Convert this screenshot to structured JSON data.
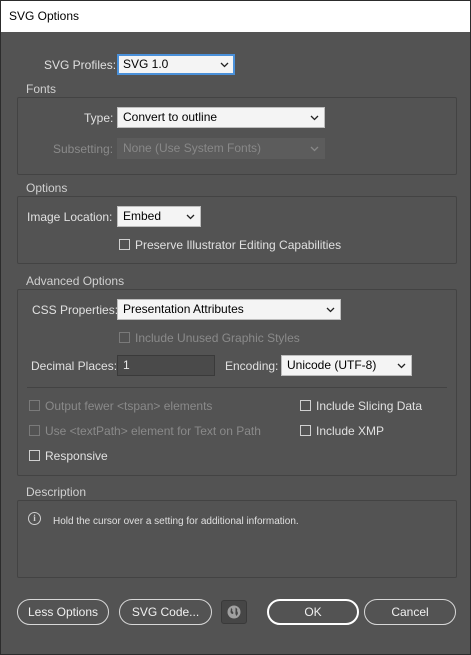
{
  "window": {
    "title": "SVG Options"
  },
  "profiles": {
    "label": "SVG Profiles:",
    "value": "SVG 1.0"
  },
  "fonts": {
    "section": "Fonts",
    "type_label": "Type:",
    "type_value": "Convert to outline",
    "subsetting_label": "Subsetting:",
    "subsetting_value": "None (Use System Fonts)"
  },
  "options": {
    "section": "Options",
    "image_location_label": "Image Location:",
    "image_location_value": "Embed",
    "preserve_label": "Preserve Illustrator Editing Capabilities"
  },
  "advanced": {
    "section": "Advanced Options",
    "css_label": "CSS Properties:",
    "css_value": "Presentation Attributes",
    "unused_styles_label": "Include Unused Graphic Styles",
    "decimal_label": "Decimal Places:",
    "decimal_value": "1",
    "encoding_label": "Encoding:",
    "encoding_value": "Unicode (UTF-8)",
    "fewer_tspan_label": "Output fewer <tspan> elements",
    "textpath_label": "Use <textPath> element for Text on Path",
    "responsive_label": "Responsive",
    "slicing_label": "Include Slicing Data",
    "xmp_label": "Include XMP"
  },
  "description": {
    "section": "Description",
    "text": "Hold the cursor over a setting for additional information."
  },
  "buttons": {
    "less_options": "Less Options",
    "svg_code": "SVG Code...",
    "ok": "OK",
    "cancel": "Cancel"
  }
}
